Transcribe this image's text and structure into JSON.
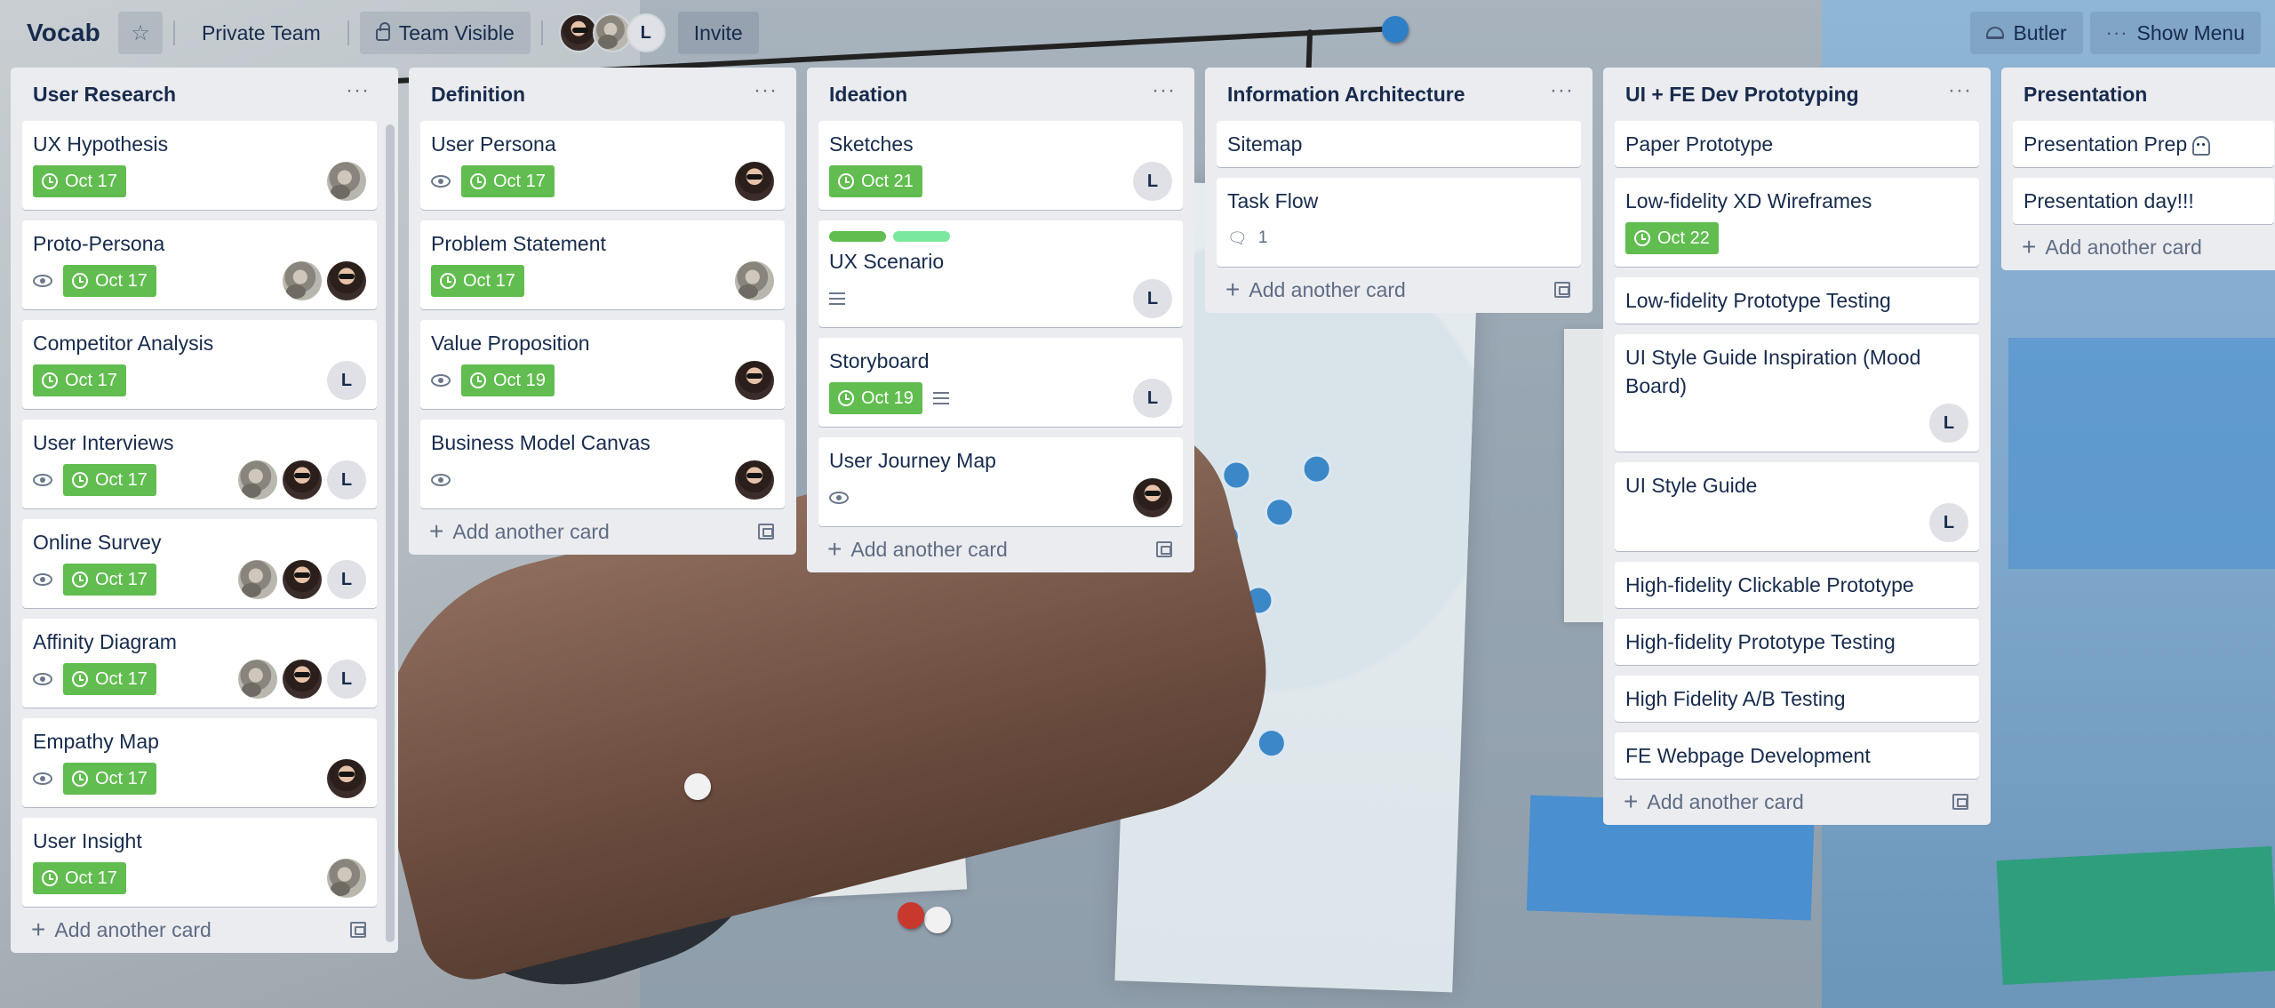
{
  "board": {
    "title": "Vocab",
    "visibility_team": "Private Team",
    "visibility_label": "Team Visible",
    "members": [
      {
        "type": "photo-a"
      },
      {
        "type": "photo-b"
      },
      {
        "type": "letter",
        "initial": "L"
      }
    ],
    "invite_label": "Invite",
    "butler_label": "Butler",
    "show_menu_label": "Show Menu",
    "add_card_label": "Add another card"
  },
  "colors": {
    "due_badge": "#61bd4f",
    "list_bg": "#ebecf0",
    "label_green": "#61bd4f",
    "label_lime": "#7be89f"
  },
  "lists": [
    {
      "title": "User Research",
      "cards": [
        {
          "title": "UX Hypothesis",
          "due": "Oct 17",
          "watch": false,
          "members": [
            "b"
          ]
        },
        {
          "title": "Proto-Persona",
          "due": "Oct 17",
          "watch": true,
          "members": [
            "b",
            "a"
          ]
        },
        {
          "title": "Competitor Analysis",
          "due": "Oct 17",
          "watch": false,
          "members": [
            "L"
          ]
        },
        {
          "title": "User Interviews",
          "due": "Oct 17",
          "watch": true,
          "members": [
            "b",
            "a",
            "L"
          ]
        },
        {
          "title": "Online Survey",
          "due": "Oct 17",
          "watch": true,
          "members": [
            "b",
            "a",
            "L"
          ]
        },
        {
          "title": "Affinity Diagram",
          "due": "Oct 17",
          "watch": true,
          "members": [
            "b",
            "a",
            "L"
          ]
        },
        {
          "title": "Empathy Map",
          "due": "Oct 17",
          "watch": true,
          "members": [
            "a"
          ]
        },
        {
          "title": "User Insight",
          "due": "Oct 17",
          "watch": false,
          "members": [
            "b"
          ]
        }
      ]
    },
    {
      "title": "Definition",
      "cards": [
        {
          "title": "User Persona",
          "due": "Oct 17",
          "watch": true,
          "members": [
            "a"
          ]
        },
        {
          "title": "Problem Statement",
          "due": "Oct 17",
          "watch": false,
          "members": [
            "b"
          ]
        },
        {
          "title": "Value Proposition",
          "due": "Oct 19",
          "watch": true,
          "members": [
            "a"
          ]
        },
        {
          "title": "Business Model Canvas",
          "watch": true,
          "members": [
            "a"
          ]
        }
      ]
    },
    {
      "title": "Ideation",
      "cards": [
        {
          "title": "Sketches",
          "due": "Oct 21",
          "watch": false,
          "members": [
            "L"
          ]
        },
        {
          "title": "UX Scenario",
          "labels": [
            "#61bd4f",
            "#7be89f"
          ],
          "description": true,
          "members": [
            "L"
          ]
        },
        {
          "title": "Storyboard",
          "due": "Oct 19",
          "description": true,
          "members": [
            "L"
          ]
        },
        {
          "title": "User Journey Map",
          "watch": true,
          "members": [
            "a"
          ]
        }
      ]
    },
    {
      "title": "Information Architecture",
      "cards": [
        {
          "title": "Sitemap"
        },
        {
          "title": "Task Flow",
          "comments": "1"
        }
      ]
    },
    {
      "title": "UI + FE Dev Prototyping",
      "cards": [
        {
          "title": "Paper Prototype"
        },
        {
          "title": "Low-fidelity XD Wireframes",
          "due": "Oct 22"
        },
        {
          "title": "Low-fidelity Prototype Testing"
        },
        {
          "title": "UI Style Guide Inspiration (Mood Board)",
          "members": [
            "L"
          ]
        },
        {
          "title": "UI Style Guide",
          "members": [
            "L"
          ]
        },
        {
          "title": "High-fidelity Clickable Prototype"
        },
        {
          "title": "High-fidelity Prototype Testing"
        },
        {
          "title": "High Fidelity A/B Testing"
        },
        {
          "title": "FE Webpage Development"
        }
      ]
    },
    {
      "title": "Presentation",
      "cards": [
        {
          "title": "Presentation Prep",
          "ghost": true
        },
        {
          "title": "Presentation day!!!"
        }
      ]
    }
  ]
}
